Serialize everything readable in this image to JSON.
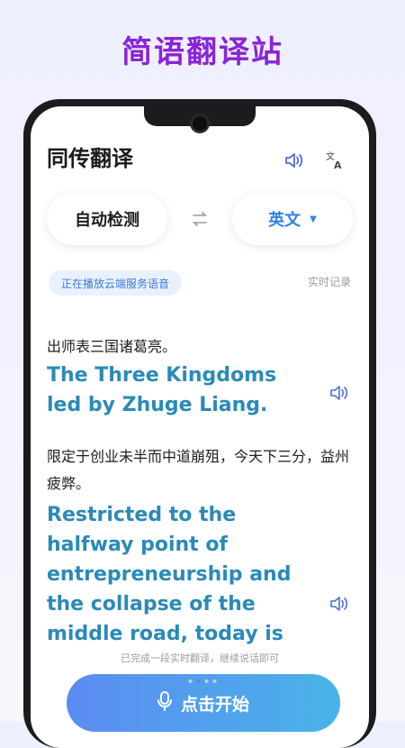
{
  "banner": {
    "title": "简语翻译站"
  },
  "app": {
    "title": "同传翻译",
    "icons": {
      "speaker": "speaker-icon",
      "translate": "translate-icon",
      "swap": "swap-icon",
      "mic": "microphone-icon",
      "dropdown": "caret-down-icon"
    }
  },
  "languages": {
    "source": "自动检测",
    "target": "英文",
    "target_color": "#2f82e8"
  },
  "status": {
    "badge": "正在播放云端服务语音",
    "history_link": "实时记录",
    "hint": "已完成一段实时翻译，继续说话即可"
  },
  "transcript": [
    {
      "source": "出师表三国诸葛亮。",
      "target": "The Three Kingdoms led by Zhuge Liang."
    },
    {
      "source": "限定于创业未半而中道崩殂，今天下三分，益州疲弊。",
      "target": "Restricted to the halfway point of entrepreneurship and the collapse of the middle road, today is"
    }
  ],
  "pager": {
    "count": 4,
    "active": 2
  },
  "start_button": {
    "label": "点击开始",
    "gradient": [
      "#5b8cf2",
      "#49b3e8"
    ]
  },
  "colors": {
    "accent_purple": "#8a24d8",
    "translation_text": "#2a8ab8"
  }
}
